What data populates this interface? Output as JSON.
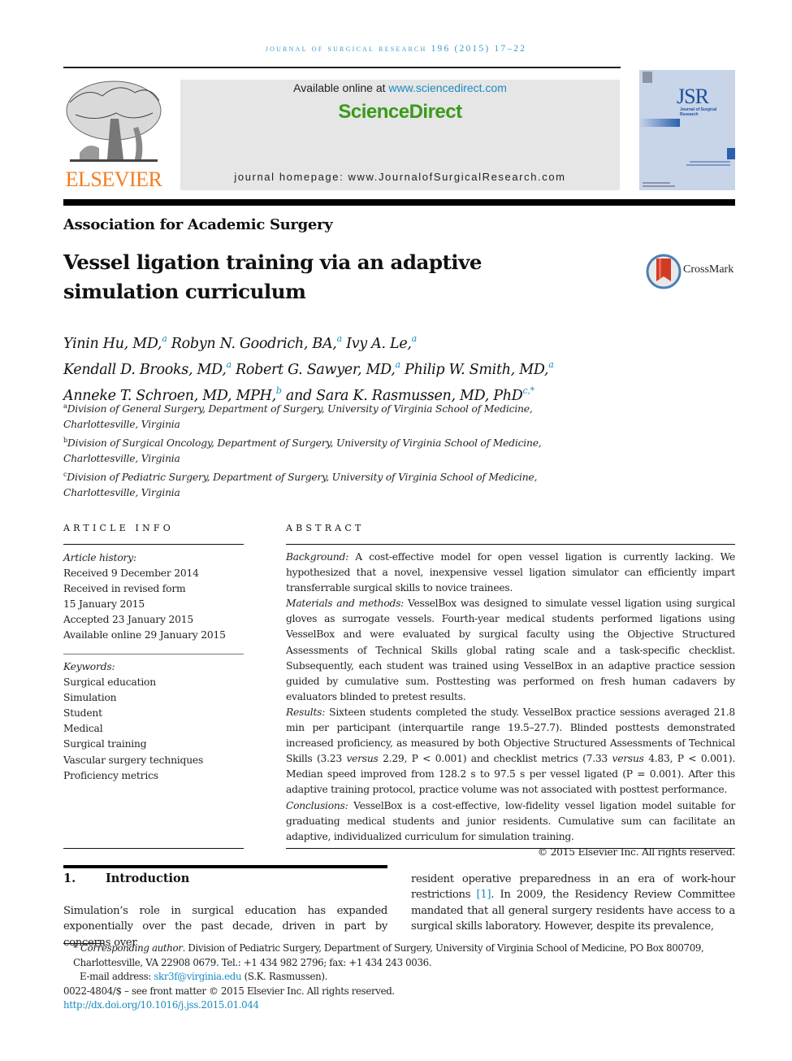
{
  "running_head": "JOURNAL OF SURGICAL RESEARCH 196 (2015) 17–22",
  "publisher": {
    "logo_text": "ELSEVIER",
    "colors": {
      "publisher_orange": "#f47c20",
      "sciencedirect_green": "#3a9a1a",
      "link_blue": "#1a8ac0",
      "cover_blue": "#1c4f9c"
    }
  },
  "sciencedirect": {
    "available_prefix": "Available online at ",
    "available_link": "www.sciencedirect.com",
    "brand": "ScienceDirect",
    "homepage": "journal homepage: www.JournalofSurgicalResearch.com"
  },
  "cover": {
    "abbrev": "JSR",
    "subtitle": "Journal of Surgical Research"
  },
  "section_label": "Association for Academic Surgery",
  "title": "Vessel ligation training via an adaptive simulation curriculum",
  "crossmark": {
    "label": "CrossMark"
  },
  "authors": [
    {
      "name": "Yinin Hu, MD,",
      "aff": "a"
    },
    {
      "name": "Robyn N. Goodrich, BA,",
      "aff": "a"
    },
    {
      "name": "Ivy A. Le,",
      "aff": "a"
    },
    {
      "name": "Kendall D. Brooks, MD,",
      "aff": "a"
    },
    {
      "name": "Robert G. Sawyer, MD,",
      "aff": "a"
    },
    {
      "name": "Philip W. Smith, MD,",
      "aff": "a"
    },
    {
      "name": "Anneke T. Schroen, MD, MPH,",
      "aff": "b"
    },
    {
      "name": "and Sara K. Rasmussen, MD, PhD",
      "aff": "c,*"
    }
  ],
  "affiliations": [
    {
      "mark": "a",
      "line1": "Division of General Surgery, Department of Surgery, University of Virginia School of Medicine,",
      "line2": "Charlottesville, Virginia"
    },
    {
      "mark": "b",
      "line1": "Division of Surgical Oncology, Department of Surgery, University of Virginia School of Medicine,",
      "line2": "Charlottesville, Virginia"
    },
    {
      "mark": "c",
      "line1": "Division of Pediatric Surgery, Department of Surgery, University of Virginia School of Medicine,",
      "line2": "Charlottesville, Virginia"
    }
  ],
  "article_info": {
    "heading": "ARTICLE INFO",
    "history_label": "Article history:",
    "history": [
      "Received 9 December 2014",
      "Received in revised form",
      "15 January 2015",
      "Accepted 23 January 2015",
      "Available online 29 January 2015"
    ],
    "keywords_label": "Keywords:",
    "keywords": [
      "Surgical education",
      "Simulation",
      "Student",
      "Medical",
      "Surgical training",
      "Vascular surgery techniques",
      "Proficiency metrics"
    ]
  },
  "abstract": {
    "heading": "ABSTRACT",
    "background_label": "Background:",
    "background": " A cost-effective model for open vessel ligation is currently lacking. We hypothesized that a novel, inexpensive vessel ligation simulator can efficiently impart transferrable surgical skills to novice trainees.",
    "methods_label": "Materials and methods:",
    "methods": " VesselBox was designed to simulate vessel ligation using surgical gloves as surrogate vessels. Fourth-year medical students performed ligations using VesselBox and were evaluated by surgical faculty using the Objective Structured Assessments of Technical Skills global rating scale and a task-specific checklist. Subsequently, each student was trained using VesselBox in an adaptive practice session guided by cumulative sum. Posttesting was performed on fresh human cadavers by evaluators blinded to pretest results.",
    "results_label": "Results:",
    "results_1": " Sixteen students completed the study. VesselBox practice sessions averaged 21.8 min per participant (interquartile range 19.5–27.7). Blinded posttests demonstrated increased proficiency, as measured by both Objective Structured Assessments of Technical Skills (3.23 ",
    "versus": "versus",
    "results_2": " 2.29, P < 0.001) and checklist metrics (7.33 ",
    "results_3": " 4.83, P < 0.001). Median speed improved from 128.2 s to 97.5 s per vessel ligated (P = 0.001). After this adaptive training protocol, practice volume was not associated with posttest performance.",
    "conclusions_label": "Conclusions:",
    "conclusions": " VesselBox is a cost-effective, low-fidelity vessel ligation model suitable for graduating medical students and junior residents. Cumulative sum can facilitate an adaptive, individualized curriculum for simulation training.",
    "copyright": "© 2015 Elsevier Inc. All rights reserved."
  },
  "introduction": {
    "number": "1.",
    "heading": "Introduction",
    "left_text": "Simulation’s role in surgical education has expanded exponentially over the past decade, driven in part by concerns over",
    "right_text_1": "resident operative preparedness in an era of work-hour restrictions ",
    "citation": "[1]",
    "right_text_2": ". In 2009, the Residency Review Committee mandated that all general surgery residents have access to a surgical skills laboratory. However, despite its prevalence,"
  },
  "footnotes": {
    "corresponding_mark": "* ",
    "corresponding_label": "Corresponding author",
    "corresponding_text": ". Division of Pediatric Surgery, Department of Surgery, University of Virginia School of Medicine, PO Box 800709, Charlottesville, VA 22908 0679. Tel.: +1 434 982 2796; fax: +1 434 243 0036.",
    "email_label": "E-mail address: ",
    "email": "skr3f@virginia.edu",
    "email_suffix": " (S.K. Rasmussen).",
    "issn": "0022-4804/$ – see front matter © 2015 Elsevier Inc. All rights reserved.",
    "doi": "http://dx.doi.org/10.1016/j.jss.2015.01.044"
  }
}
